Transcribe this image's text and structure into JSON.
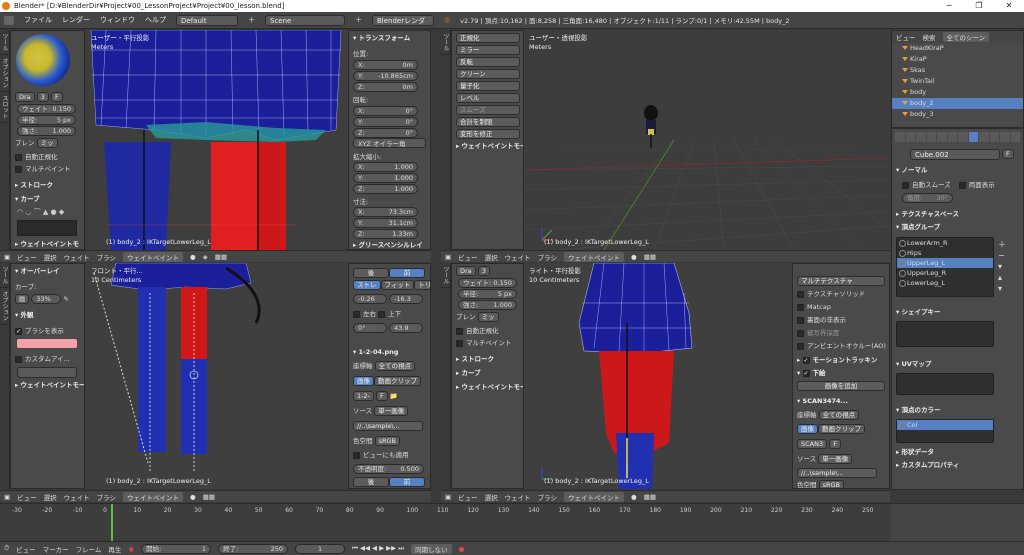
{
  "titlebar": {
    "title": "Blender* [D:¥BlenderDir¥Project¥00_LessonProject¥Project¥00_lesson.blend]",
    "minimize": "─",
    "restore": "❐",
    "close": "✕"
  },
  "menubar": {
    "items": [
      "ファイル",
      "レンダー",
      "ウィンドウ",
      "ヘルプ"
    ],
    "layout": "Default",
    "scene": "Scene",
    "render_engine": "Blenderレンダー",
    "stats": "v2.79 | 頂点:10,162 | 面:8,258 | 三角面:16,480 | オブジェクト:1/11 | ランプ:0/1 | メモリ:42.55M | body_2"
  },
  "tool_shelf_top": {
    "tabs": [
      "ツール",
      "オプション",
      "スロット"
    ],
    "draw_label": "Dra",
    "draw_count": "3",
    "weight_label": "ウェイト:",
    "weight_value": "0.150",
    "radius_label": "半径:",
    "radius_value": "5 px",
    "strength_label": "強さ:",
    "strength_value": "1.000",
    "blend_label": "ブレン",
    "blend_value": "ミッ",
    "auto_normalize": "自動正規化",
    "multipaint": "マルチペイント",
    "stroke": "ストローク",
    "curve": "カーブ",
    "weight_paint_mode": "ウェイトペイントモ"
  },
  "vp_top_left": {
    "view": "ユーザー・平行投影",
    "units": "Meters",
    "object": "(1) body_2 : IKTargetLowerLeg_L"
  },
  "transform": {
    "title": "トランスフォーム",
    "location": "位置:",
    "x": "X:",
    "loc_x": "0m",
    "y": "Y:",
    "loc_y": "-10.865cm",
    "z": "Z:",
    "loc_z": "0m",
    "rotation": "回転:",
    "rot_x": "0°",
    "rot_y": "0°",
    "rot_z": "0°",
    "mode": "XYZ オイラー角",
    "scale": "拡大縮小:",
    "scl_x": "1.000",
    "scl_y": "1.000",
    "scl_z": "1.000",
    "dimensions": "寸法:",
    "dim_x": "73.3cm",
    "dim_y": "31.1cm",
    "dim_z": "1.33m",
    "grease": "グリースペンシルレイ"
  },
  "tool_col_2": {
    "buttons": [
      "正規化",
      "ミラー",
      "反転",
      "クリーン",
      "量子化",
      "レベル",
      "スムーズ",
      "合計を制限",
      "変形を修正"
    ],
    "footer": "ウェイトペイントモード"
  },
  "vp_top_right": {
    "view": "ユーザー・透視投影",
    "units": "Meters",
    "object": "(1) body_2 : IKTargetLowerLeg_L"
  },
  "viewport_header": {
    "view": "ビュー",
    "select": "選択",
    "weight": "ウェイト",
    "brush": "ブラシ",
    "mode": "ウェイトペイント"
  },
  "outliner": {
    "view": "ビュー",
    "search": "検索",
    "scenes": "全てのシーン",
    "rows": [
      "HeadKiraP",
      "KiraP",
      "Skas",
      "TwinTail",
      "body",
      "body_2",
      "body_3"
    ]
  },
  "properties_right": {
    "object_name": "Cube.002",
    "f": "F",
    "normal": "ノーマル",
    "auto_smooth": "自動スムーズ",
    "double_sided": "両面表示",
    "angle_label": "角度:",
    "angle_value": "30°",
    "texture_space": "テクスチャスペース",
    "vertex_groups": "頂点グループ",
    "groups": [
      "LowerArm_R",
      "Hips",
      "UpperLeg_L",
      "UpperLeg_R",
      "LowerLeg_L"
    ],
    "shape_keys": "シェイプキー",
    "uv_maps": "UVマップ",
    "vertex_colors": "頂点のカラー",
    "col": "Col",
    "shape_data": "形状データ",
    "custom_props": "カスタムプロパティ"
  },
  "tool_shelf_bottom": {
    "overlay": "オーバーレイ",
    "curve": "カーブ:",
    "percent": "33%",
    "appearance": "外観",
    "show_brush": "ブラシを表示",
    "custom_icon": "カスタムアイ...",
    "footer": "ウェイトペイントモード"
  },
  "vp_bottom_left": {
    "view": "フロント・平行...",
    "units": "10 Centimeters",
    "object": "(1) body_2 : IKTargetLowerLeg_L"
  },
  "image_panel": {
    "back": "後",
    "front": "前",
    "straight": "ストレ",
    "fit": "フィット",
    "crop": "トリム",
    "x": "-0.26",
    "y": "-16.3",
    "left_right": "左右",
    "up_down": "上下",
    "rot": "0°",
    "size": "43.9",
    "image_name": "1-2-04.png",
    "coord": "座標軸",
    "all_views": "全ての視点",
    "image_btn": "画像",
    "movie_btn": "動画クリップ",
    "image_field": "1-2-",
    "source": "ソース",
    "single_image": "単一画像",
    "path": "//..\\sample\\...",
    "color_space": "色空間",
    "srgb": "sRGB",
    "view_as_render": "ビューにも適用",
    "opacity_label": "不透明度:",
    "opacity": "0.500"
  },
  "tool_shelf_bottom2": {
    "draw_label": "Dra",
    "draw_count": "3",
    "weight_label": "ウェイト:",
    "weight_value": "0.150",
    "radius_label": "半径:",
    "radius_value": "5 px",
    "strength_label": "強さ:",
    "strength_value": "1.000",
    "blend_label": "ブレン",
    "blend_value": "ミッ",
    "auto_normalize": "自動正規化",
    "multipaint": "マルチペイント",
    "stroke": "ストローク",
    "curve": "カーブ",
    "footer": "ウェイトペイントモード"
  },
  "vp_bottom_right": {
    "view": "ライト・平行投影",
    "units": "10 Centimeters",
    "object": "(1) body_2 : IKTargetLowerLeg_L"
  },
  "shading_panel": {
    "multitexture": "マルチテクスチャ",
    "texture_solid": "テクスチャソリッド",
    "matcap": "Matcap",
    "backface": "裏面の非表示",
    "depth": "被写界深度",
    "ao": "アンビエントオクルー(AO)",
    "motion": "モーショントラッキン",
    "background": "下絵",
    "add_image": "画像を追加",
    "scan_name": "SCAN3474...",
    "coord": "座標軸",
    "all_views": "全ての視点",
    "image_btn": "画像",
    "movie_btn": "動画クリップ",
    "scan_field": "SCAN3",
    "source": "ソース",
    "single_image": "単一画像",
    "path": "//..\\sample\\...",
    "color_space": "色空間",
    "srgb": "sRGB"
  },
  "timeline": {
    "ticks": [
      "-30",
      "-20",
      "-10",
      "0",
      "10",
      "20",
      "30",
      "40",
      "50",
      "60",
      "70",
      "80",
      "90",
      "100",
      "110",
      "120",
      "130",
      "140",
      "150",
      "160",
      "170",
      "180",
      "190",
      "200",
      "210",
      "220",
      "230",
      "240",
      "250"
    ],
    "view": "ビュー",
    "marker": "マーカー",
    "frame": "フレーム",
    "playback": "再生",
    "start_label": "開始:",
    "start": "1",
    "end_label": "終了:",
    "end": "250",
    "current": "1",
    "sync": "同期しない"
  },
  "colors": {
    "accent": "#5680c2",
    "vertex_blue": "#1a1a8c",
    "weight_red": "#e02020",
    "brand_orange": "#e87d0d"
  }
}
